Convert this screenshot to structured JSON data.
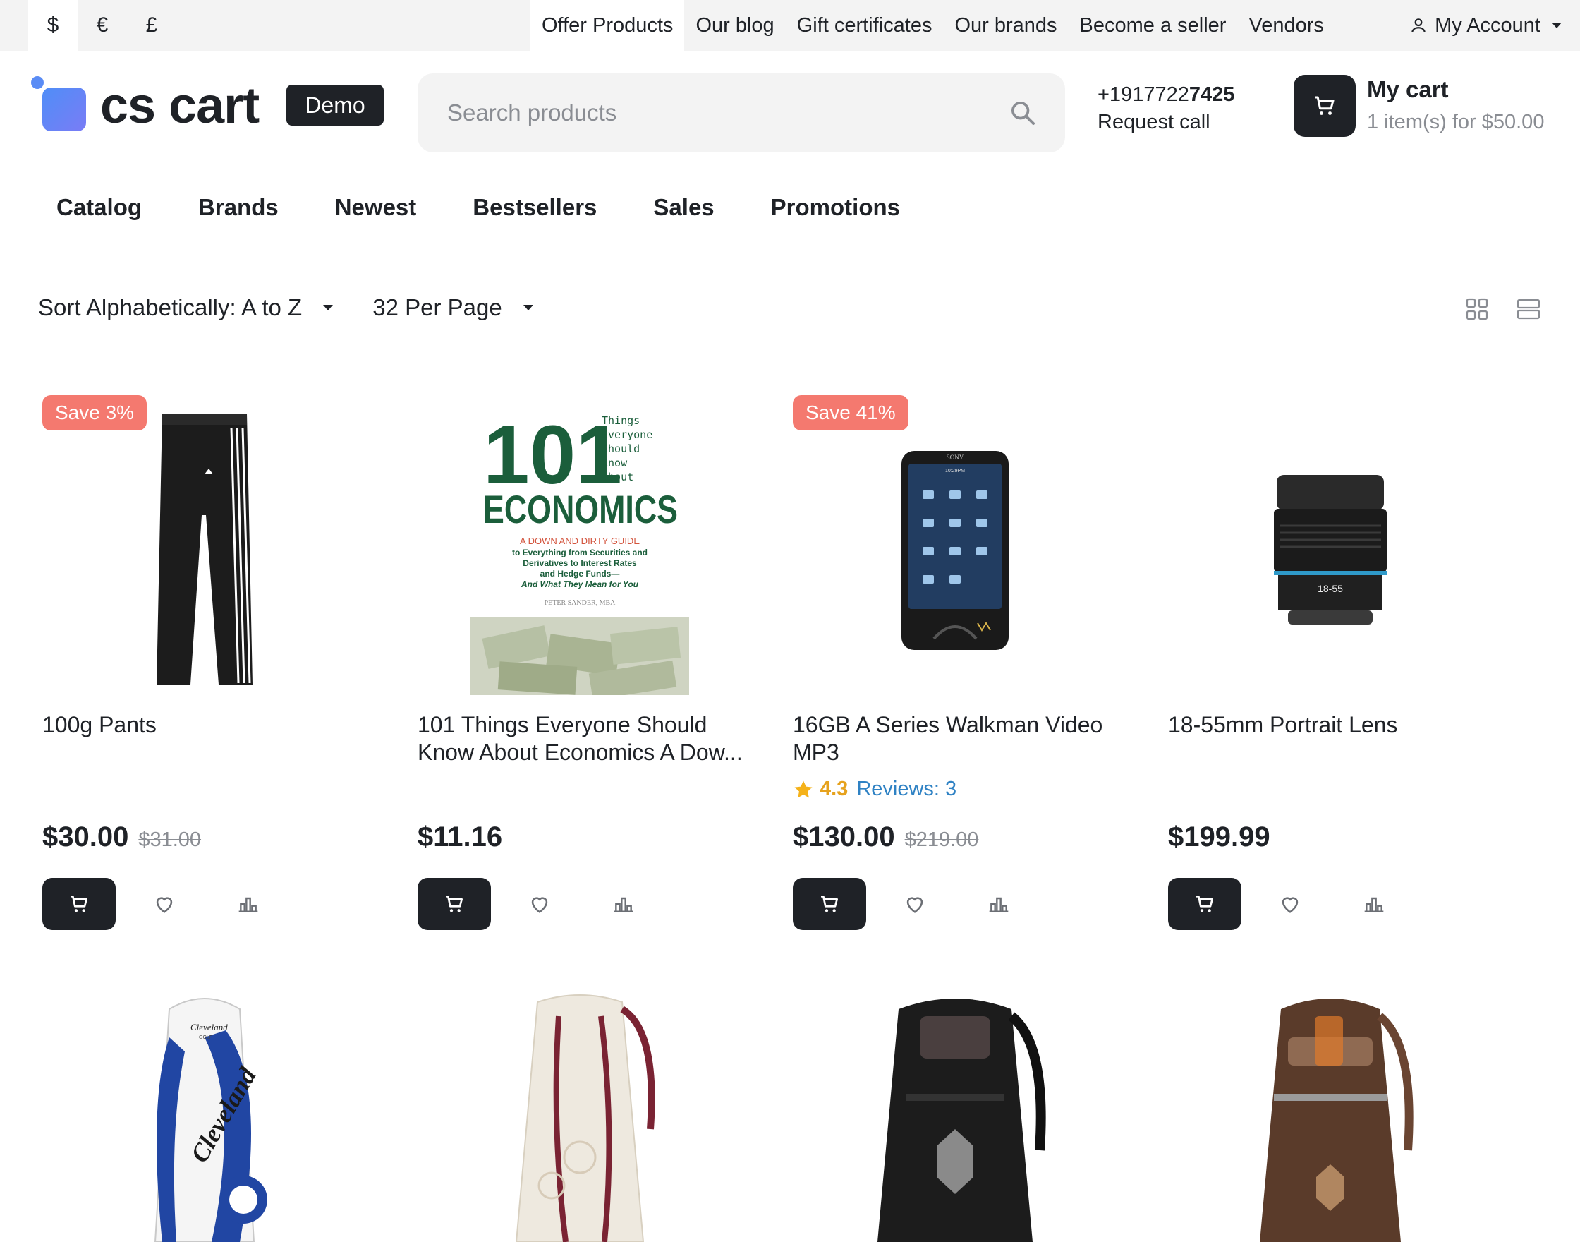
{
  "currencies": [
    {
      "symbol": "$",
      "active": true
    },
    {
      "symbol": "€",
      "active": false
    },
    {
      "symbol": "£",
      "active": false
    }
  ],
  "top_links": [
    "Offer Products",
    "Our blog",
    "Gift certificates",
    "Our brands",
    "Become a seller",
    "Vendors"
  ],
  "account": {
    "label": "My Account",
    "icon": "user-icon"
  },
  "logo": {
    "text": "cs cart",
    "badge": "Demo"
  },
  "search": {
    "placeholder": "Search products",
    "value": "",
    "icon": "search-icon"
  },
  "contact": {
    "phone_prefix": "+1917722",
    "phone_suffix": "7425",
    "request_call": "Request call"
  },
  "cart": {
    "title": "My cart",
    "summary": "1 item(s) for $50.00",
    "icon": "cart-icon"
  },
  "nav": [
    "Catalog",
    "Brands",
    "Newest",
    "Bestsellers",
    "Sales",
    "Promotions"
  ],
  "sorting": {
    "sort_label": "Sort Alphabetically: A to Z",
    "per_page_label": "32 Per Page"
  },
  "view_modes": [
    "grid-view-icon",
    "list-view-icon"
  ],
  "products": [
    {
      "badge": "Save 3%",
      "title": "100g Pants",
      "price": "$30.00",
      "old_price": "$31.00",
      "rating": "",
      "reviews": "",
      "image": "pants-image"
    },
    {
      "badge": "",
      "title": "101 Things Everyone Should Know About Economics A Dow...",
      "price": "$11.16",
      "old_price": "",
      "rating": "",
      "reviews": "",
      "image": "economics-book-cover"
    },
    {
      "badge": "Save 41%",
      "title": "16GB A Series Walkman Video MP3",
      "price": "$130.00",
      "old_price": "$219.00",
      "rating": "4.3",
      "reviews": "Reviews: 3",
      "image": "walkman-player-image"
    },
    {
      "badge": "",
      "title": "18-55mm Portrait Lens",
      "price": "$199.99",
      "old_price": "",
      "rating": "",
      "reviews": "",
      "image": "camera-lens-image"
    }
  ],
  "book_cover": {
    "big": "101",
    "side": [
      "Things",
      "Everyone",
      "Should",
      "Know",
      "about"
    ],
    "title": "ECONOMICS",
    "subtitle": [
      "A DOWN AND DIRTY GUIDE",
      "to Everything from Securities and",
      "Derivatives to Interest Rates",
      "and Hedge Funds—",
      "And What They Mean for You"
    ],
    "author": "PETER SANDER, MBA"
  },
  "walkman_brand": "SONY",
  "walkman_time": "10:29PM",
  "lens_label": "18-55",
  "bag_brand": "Cleveland",
  "bag_sub": "GOLF",
  "bag_logo": "Cleveland",
  "row2_images": [
    "golf-bag-image",
    "white-backpack-image",
    "black-backpack-image",
    "brown-backpack-image"
  ],
  "colors": {
    "dark": "#1f2227",
    "badge": "#f4796f",
    "muted": "#8a8d93",
    "link": "#2f82c4",
    "star": "#e6a21d",
    "topbar": "#f3f3f3"
  }
}
